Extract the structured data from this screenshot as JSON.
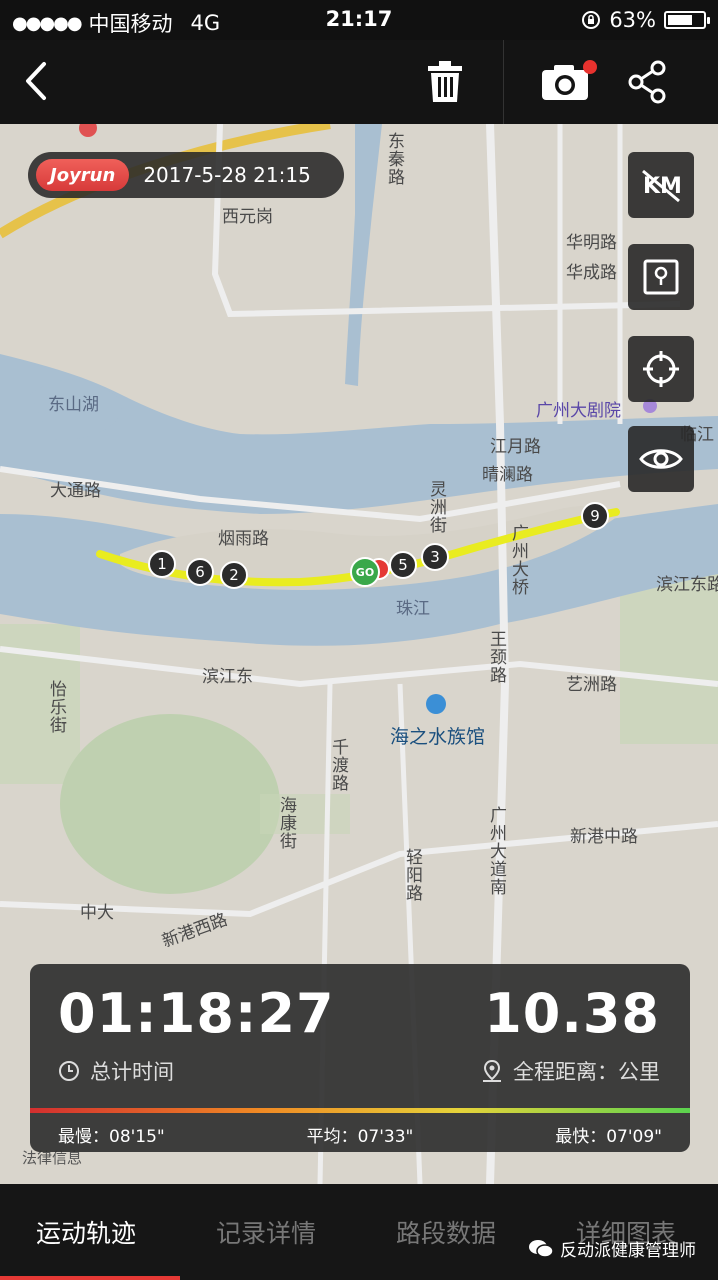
{
  "status_bar": {
    "signal": "●●●●●",
    "carrier": "中国移动",
    "network": "4G",
    "time": "21:17",
    "battery": "63%"
  },
  "toolbar": {
    "back_icon": "chevron-left-icon",
    "trash_icon": "trash-icon",
    "camera_icon": "camera-icon",
    "share_icon": "share-icon"
  },
  "header": {
    "brand": "Joyrun",
    "datetime": "2017-5-28 21:15"
  },
  "map": {
    "labels": {
      "xiyuangang": "西元岗",
      "huaming": "华明路",
      "huacheng": "华成路",
      "dongshanhu": "东山湖",
      "grand_theatre": "广州大剧院",
      "dongsanlu": "东秦路",
      "linjiang": "临江",
      "jiangyue": "江月路",
      "qinglan": "晴澜路",
      "datong": "大通路",
      "yanyu": "烟雨路",
      "lingzhou": "灵洲街",
      "guangzhou_bridge": "广州大桥",
      "binjiangdong_right": "滨江东路",
      "zhujiang": "珠江",
      "binjiangdong": "滨江东",
      "yuefu": "怡乐街",
      "wangzhou": "王颈路",
      "yizhou": "艺洲路",
      "aquarium": "海之水族馆",
      "gandu": "千渡路",
      "haikang": "海康街",
      "guangzhou_ave_south": "广州大道南",
      "xingang_zhong": "新港中路",
      "xingang_xi": "新港西路",
      "zhongda": "中大",
      "yimin": "轻阳路",
      "legal": "法律信息"
    },
    "markers": [
      "1",
      "6",
      "2",
      "5",
      "3",
      "9"
    ],
    "go_label": "GO",
    "side_buttons": [
      "km-toggle-icon",
      "map-layer-icon",
      "locate-icon",
      "eye-icon"
    ]
  },
  "stats": {
    "duration": "01:18:27",
    "duration_label": "总计时间",
    "distance": "10.38",
    "distance_label": "全程距离：公里",
    "slowest": "最慢：08'15\"",
    "average": "平均：07'33\"",
    "fastest": "最快：07'09\""
  },
  "tabs": [
    {
      "label": "运动轨迹",
      "active": true
    },
    {
      "label": "记录详情",
      "active": false
    },
    {
      "label": "路段数据",
      "active": false
    },
    {
      "label": "详细图表",
      "active": false
    }
  ],
  "watermark": "反动派健康管理师"
}
